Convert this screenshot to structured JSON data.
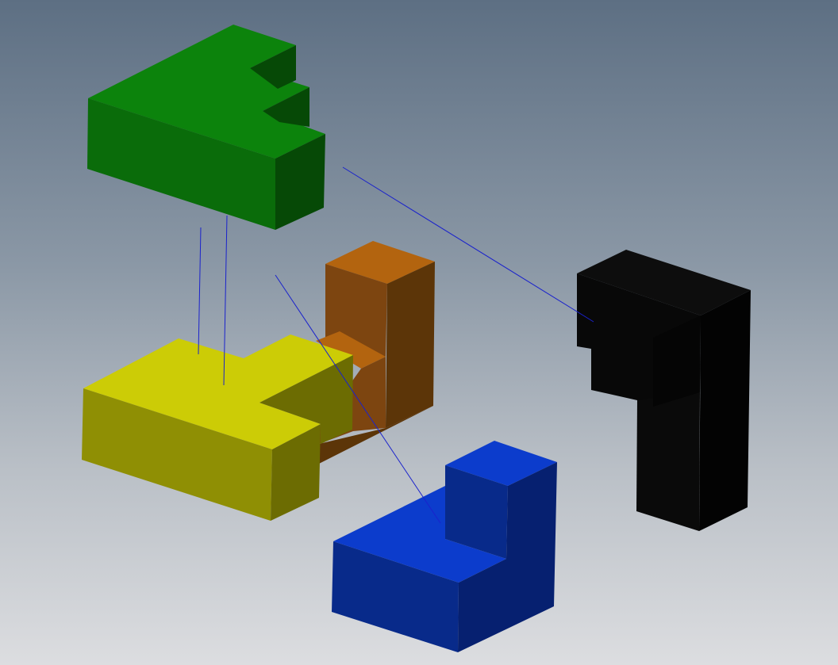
{
  "viewport": {
    "background_top": "#5d6f83",
    "background_bottom": "#dcdde0"
  },
  "pieces": [
    {
      "name": "green-piece",
      "color": "green",
      "faces": {
        "top": "#0c830c",
        "front": "#0a6c0a",
        "side": "#064906"
      }
    },
    {
      "name": "yellow-piece",
      "color": "yellow",
      "faces": {
        "top": "#cccc06",
        "front": "#8f8f04",
        "side": "#6c6c02"
      }
    },
    {
      "name": "orange-piece",
      "color": "orange",
      "faces": {
        "top": "#b3640f",
        "front": "#7d4510",
        "side": "#5c3508"
      }
    },
    {
      "name": "black-piece",
      "color": "black",
      "faces": {
        "top": "#0d0d0d",
        "front": "#080808",
        "side": "#030303"
      }
    },
    {
      "name": "blue-piece",
      "color": "blue",
      "faces": {
        "top": "#0c3ccc",
        "front": "#082a8a",
        "side": "#062070"
      }
    }
  ],
  "connector_color": "#1a22cc"
}
